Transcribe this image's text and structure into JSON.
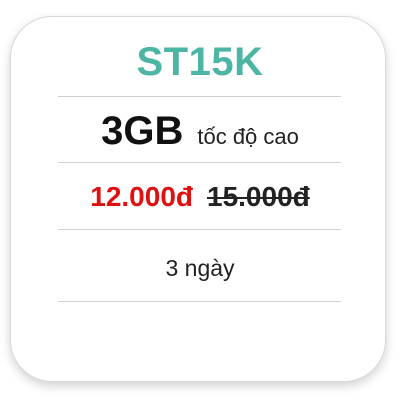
{
  "plan": {
    "name": "ST15K",
    "data_amount": "3GB",
    "data_label": "tốc độ cao",
    "price_current": "12.000đ",
    "price_old": "15.000đ",
    "duration": "3 ngày"
  },
  "colors": {
    "plan_name": "#4cb5a3",
    "price_current": "#e01010",
    "text": "#222222",
    "divider": "#cfcfcf",
    "card_border": "#d9d9d9"
  }
}
